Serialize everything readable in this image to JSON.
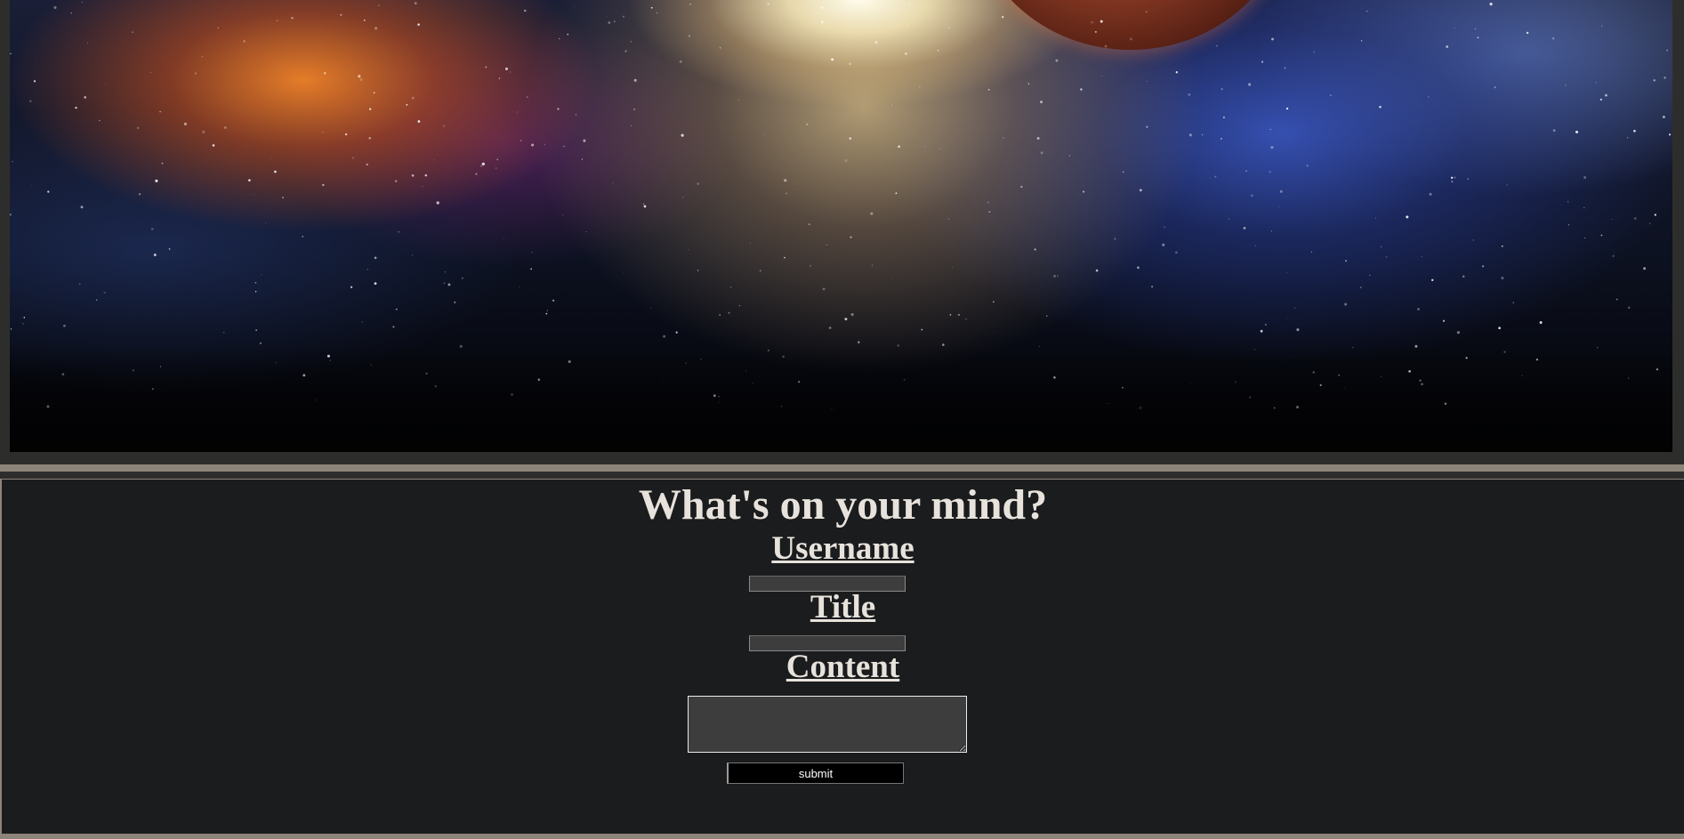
{
  "banner": {
    "image_description_icon": "space-nebula-image"
  },
  "form": {
    "heading": "What's on your mind?",
    "username_label": "Username",
    "username_value": "",
    "title_label": "Title",
    "title_value": "",
    "content_label": "Content",
    "content_value": "",
    "submit_label": "submit"
  },
  "colors": {
    "page_background": "#1b1c1e",
    "frame": "#2d2e2c",
    "accent_border": "#8c8478",
    "text": "#e7e2db",
    "input_background": "#3d3d3d",
    "button_background": "#000000"
  }
}
